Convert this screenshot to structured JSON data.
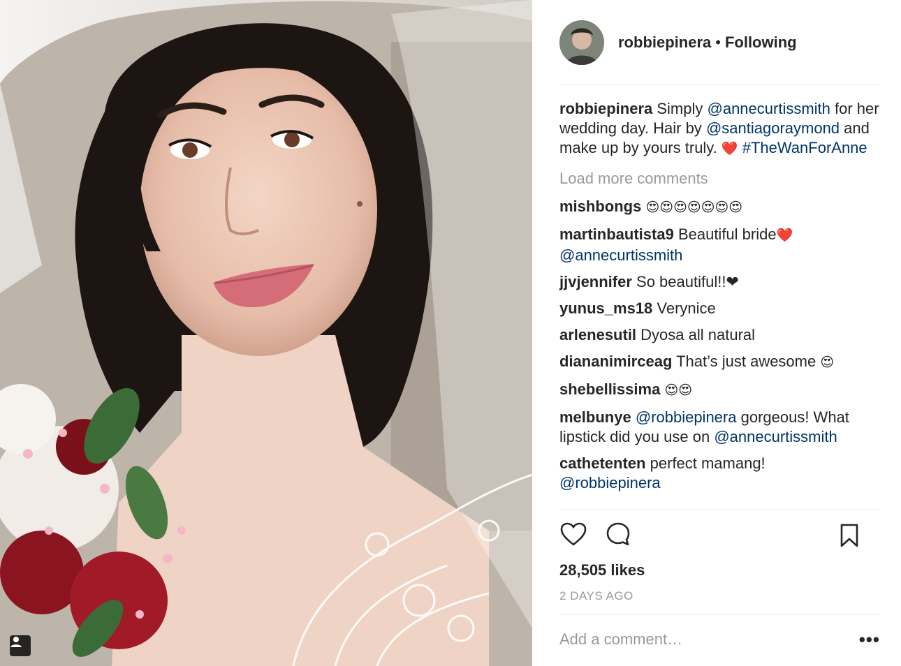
{
  "post": {
    "author": "robbiepinera",
    "separator": "•",
    "follow_status": "Following"
  },
  "caption": {
    "user": "robbiepinera",
    "text1": " Simply ",
    "mention1": "@annecurtissmith",
    "text2": " for her wedding day. Hair by ",
    "mention2": "@santiagoraymond",
    "text3": " and make up by yours truly. ",
    "heart": "❤️",
    "hashtag": "#TheWanForAnne"
  },
  "load_more": "Load more comments",
  "comments": [
    {
      "user": "mishbongs",
      "emoji": "😍😍😍😍😍😍😍"
    },
    {
      "user": "martinbautista9",
      "text": " Beautiful bride",
      "heart": "❤️",
      "mention": "@annecurtissmith"
    },
    {
      "user": "jjvjennifer",
      "text": " So beautiful!!❤"
    },
    {
      "user": "yunus_ms18",
      "text": " Verynice"
    },
    {
      "user": "arlenesutil",
      "text": " Dyosa all natural"
    },
    {
      "user": "diananimirceag",
      "text": " That’s just awesome ",
      "emoji": "😍"
    },
    {
      "user": "shebellissima",
      "emoji": "😍😍"
    },
    {
      "user": "melbunye",
      "mention": "@robbiepinera",
      "text": " gorgeous! What lipstick did you use on ",
      "mention2": "@annecurtissmith"
    },
    {
      "user": "cathetenten",
      "text": " perfect mamang! ",
      "mention": "@robbiepinera"
    }
  ],
  "likes": "28,505 likes",
  "time": "2 DAYS AGO",
  "add_comment_placeholder": "Add a comment…",
  "more_label": "•••",
  "icons": {
    "like": "heart-outline-icon",
    "comment": "comment-bubble-icon",
    "save": "bookmark-icon",
    "tagged": "user-tag-icon"
  },
  "colors": {
    "text": "#262626",
    "mention": "#003569",
    "muted": "#999999",
    "divider": "#efefef"
  }
}
